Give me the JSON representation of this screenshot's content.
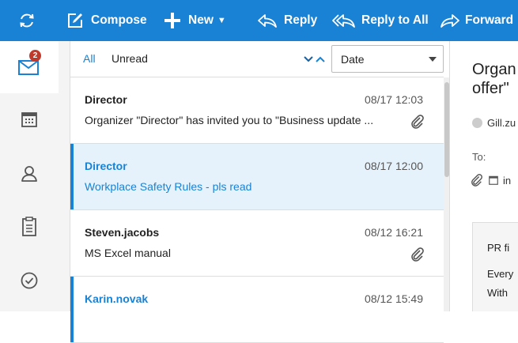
{
  "toolbar": {
    "compose_label": "Compose",
    "new_label": "New",
    "reply_label": "Reply",
    "reply_all_label": "Reply to All",
    "forward_label": "Forward",
    "accent": "#1a82d4",
    "icons": [
      "refresh-icon",
      "compose-icon",
      "plus-icon",
      "reply-icon",
      "reply-all-icon",
      "forward-icon"
    ]
  },
  "sidebar": {
    "unread_badge": "2",
    "items": [
      "mail-icon",
      "calendar-icon",
      "contacts-icon",
      "tasks-icon",
      "check-icon"
    ]
  },
  "list": {
    "filter_all": "All",
    "filter_unread": "Unread",
    "sort_value": "Date",
    "messages": [
      {
        "sender": "Director",
        "date": "08/17 12:03",
        "subject": "Organizer \"Director\" has invited you to \"Business update ...",
        "attachment": true,
        "selected": false,
        "unread": false
      },
      {
        "sender": "Director",
        "date": "08/17 12:00",
        "subject": "Workplace Safety Rules - pls read",
        "attachment": false,
        "selected": true,
        "unread": true
      },
      {
        "sender": "Steven.jacobs",
        "date": "08/12 16:21",
        "subject": "MS Excel manual",
        "attachment": true,
        "selected": false,
        "unread": false
      },
      {
        "sender": "Karin.novak",
        "date": "08/12 15:49",
        "subject": "",
        "attachment": false,
        "selected": false,
        "unread": true
      }
    ]
  },
  "reading": {
    "title": "Organ\noffer\"",
    "from": "Gill.zu",
    "to_label": "To:",
    "attachment_text": "in",
    "body_lines": [
      "PR fi",
      "Every",
      "With"
    ]
  }
}
